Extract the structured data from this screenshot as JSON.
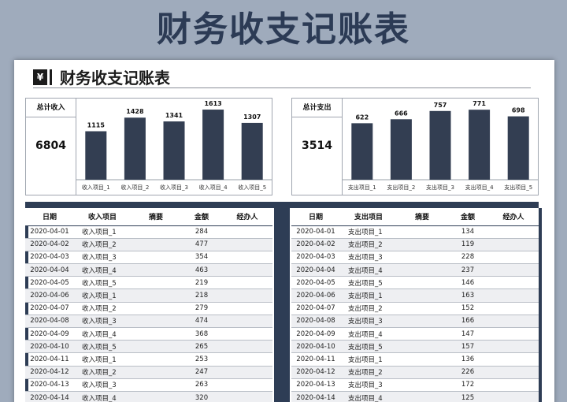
{
  "banner": {
    "title": "财务收支记账表"
  },
  "sheet": {
    "title": "财务收支记账表",
    "yen_icon": "¥"
  },
  "income_panel": {
    "total_label": "总计收入",
    "total_value": "6804"
  },
  "expense_panel": {
    "total_label": "总计支出",
    "total_value": "3514"
  },
  "chart_data": [
    {
      "type": "bar",
      "title": "",
      "categories": [
        "收入项目_1",
        "收入项目_2",
        "收入项目_3",
        "收入项目_4",
        "收入项目_5"
      ],
      "values": [
        1115,
        1428,
        1341,
        1613,
        1307
      ],
      "ylim": [
        0,
        1650
      ],
      "color": "#333e52"
    },
    {
      "type": "bar",
      "title": "",
      "categories": [
        "支出项目_1",
        "支出项目_2",
        "支出项目_3",
        "支出项目_4",
        "支出项目_5"
      ],
      "values": [
        622,
        666,
        757,
        771,
        698
      ],
      "ylim": [
        0,
        790
      ],
      "color": "#333e52"
    }
  ],
  "tables": {
    "headers": [
      "日期",
      "收入项目",
      "摘要",
      "金额",
      "经办人"
    ],
    "expense_headers": [
      "日期",
      "支出项目",
      "摘要",
      "金额",
      "经办人"
    ],
    "income_rows": [
      [
        "2020-04-01",
        "收入项目_1",
        "",
        "284",
        ""
      ],
      [
        "2020-04-02",
        "收入项目_2",
        "",
        "477",
        ""
      ],
      [
        "2020-04-03",
        "收入项目_3",
        "",
        "354",
        ""
      ],
      [
        "2020-04-04",
        "收入项目_4",
        "",
        "463",
        ""
      ],
      [
        "2020-04-05",
        "收入项目_5",
        "",
        "219",
        ""
      ],
      [
        "2020-04-06",
        "收入项目_1",
        "",
        "218",
        ""
      ],
      [
        "2020-04-07",
        "收入项目_2",
        "",
        "279",
        ""
      ],
      [
        "2020-04-08",
        "收入项目_3",
        "",
        "474",
        ""
      ],
      [
        "2020-04-09",
        "收入项目_4",
        "",
        "368",
        ""
      ],
      [
        "2020-04-10",
        "收入项目_5",
        "",
        "265",
        ""
      ],
      [
        "2020-04-11",
        "收入项目_1",
        "",
        "253",
        ""
      ],
      [
        "2020-04-12",
        "收入项目_2",
        "",
        "247",
        ""
      ],
      [
        "2020-04-13",
        "收入项目_3",
        "",
        "263",
        ""
      ],
      [
        "2020-04-14",
        "收入项目_4",
        "",
        "320",
        ""
      ]
    ],
    "expense_rows": [
      [
        "2020-04-01",
        "支出项目_1",
        "",
        "134",
        ""
      ],
      [
        "2020-04-02",
        "支出项目_2",
        "",
        "119",
        ""
      ],
      [
        "2020-04-03",
        "支出项目_3",
        "",
        "228",
        ""
      ],
      [
        "2020-04-04",
        "支出项目_4",
        "",
        "237",
        ""
      ],
      [
        "2020-04-05",
        "支出项目_5",
        "",
        "146",
        ""
      ],
      [
        "2020-04-06",
        "支出项目_1",
        "",
        "163",
        ""
      ],
      [
        "2020-04-07",
        "支出项目_2",
        "",
        "152",
        ""
      ],
      [
        "2020-04-08",
        "支出项目_3",
        "",
        "166",
        ""
      ],
      [
        "2020-04-09",
        "支出项目_4",
        "",
        "147",
        ""
      ],
      [
        "2020-04-10",
        "支出项目_5",
        "",
        "157",
        ""
      ],
      [
        "2020-04-11",
        "支出项目_1",
        "",
        "136",
        ""
      ],
      [
        "2020-04-12",
        "支出项目_2",
        "",
        "226",
        ""
      ],
      [
        "2020-04-13",
        "支出项目_3",
        "",
        "172",
        ""
      ],
      [
        "2020-04-14",
        "支出项目_4",
        "",
        "125",
        ""
      ]
    ]
  }
}
